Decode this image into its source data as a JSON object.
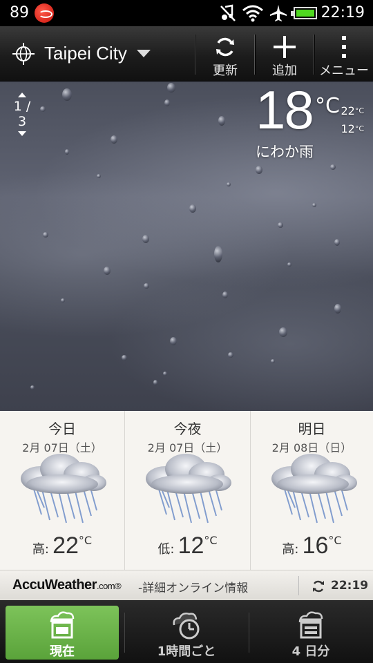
{
  "status_bar": {
    "notification_count": "89",
    "time": "22:19",
    "icons": [
      "app-notification-icon",
      "music-muted-icon",
      "wifi-icon",
      "airplane-icon",
      "battery-icon"
    ]
  },
  "action_bar": {
    "location": "Taipei City",
    "refresh_label": "更新",
    "add_label": "追加",
    "menu_label": "メニュー"
  },
  "current": {
    "page_indicator": "1 / 3",
    "temperature": "18",
    "unit": "°C",
    "high": "22",
    "low": "12",
    "small_unit": "°C",
    "condition": "にわか雨"
  },
  "forecast": [
    {
      "title": "今日",
      "date": "2月 07日（土）",
      "temp_label": "高:",
      "temp": "22",
      "unit": "°C",
      "icon": "rain-cloud-icon"
    },
    {
      "title": "今夜",
      "date": "2月 07日（土）",
      "temp_label": "低:",
      "temp": "12",
      "unit": "°C",
      "icon": "rain-cloud-icon"
    },
    {
      "title": "明日",
      "date": "2月 08日（日）",
      "temp_label": "高:",
      "temp": "16",
      "unit": "°C",
      "icon": "rain-cloud-icon"
    }
  ],
  "accuweather": {
    "logo": "AccuWeather",
    "logo_domain": ".com",
    "logo_mark": "®",
    "link_text": "-詳細オンライン情報",
    "updated_time": "22:19"
  },
  "tabs": [
    {
      "label": "現在",
      "icon": "current-weather-icon",
      "active": true
    },
    {
      "label": "1時間ごと",
      "icon": "hourly-clock-icon",
      "active": false
    },
    {
      "label": "4 日分",
      "icon": "four-day-calendar-icon",
      "active": false
    }
  ],
  "colors": {
    "active_tab": "#6db64a",
    "battery": "#4fd820",
    "forecast_bg": "#f6f4f0"
  }
}
